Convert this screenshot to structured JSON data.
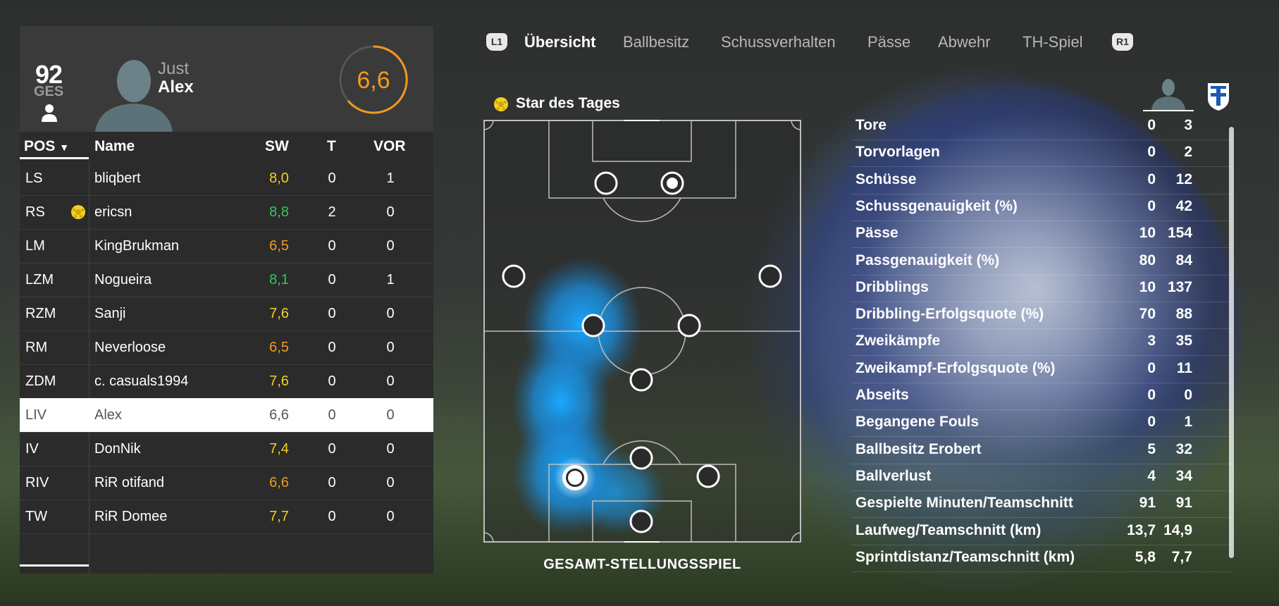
{
  "player": {
    "overall": "92",
    "overall_label": "GES",
    "first_name": "Just",
    "last_name": "Alex",
    "rating": "6,6"
  },
  "lineup": {
    "headers": {
      "pos": "POS",
      "name": "Name",
      "sw": "SW",
      "t": "T",
      "vor": "VOR"
    },
    "rows": [
      {
        "pos": "LS",
        "name": "bliqbert",
        "sw": "8,0",
        "t": "0",
        "vor": "1",
        "color": "#f5d021"
      },
      {
        "pos": "RS",
        "name": "ericsn",
        "sw": "8,8",
        "t": "2",
        "vor": "0",
        "color": "#35c75a",
        "star": true
      },
      {
        "pos": "LM",
        "name": "KingBrukman",
        "sw": "6,5",
        "t": "0",
        "vor": "0",
        "color": "#f29a1d"
      },
      {
        "pos": "LZM",
        "name": "Nogueira",
        "sw": "8,1",
        "t": "0",
        "vor": "1",
        "color": "#35c75a"
      },
      {
        "pos": "RZM",
        "name": "Sanji",
        "sw": "7,6",
        "t": "0",
        "vor": "0",
        "color": "#f5d021"
      },
      {
        "pos": "RM",
        "name": "Neverloose",
        "sw": "6,5",
        "t": "0",
        "vor": "0",
        "color": "#f29a1d"
      },
      {
        "pos": "ZDM",
        "name": "c. casuals1994",
        "sw": "7,6",
        "t": "0",
        "vor": "0",
        "color": "#f5d021"
      },
      {
        "pos": "LIV",
        "name": "Alex",
        "sw": "6,6",
        "t": "0",
        "vor": "0",
        "color": "#555555",
        "selected": true
      },
      {
        "pos": "IV",
        "name": "DonNik",
        "sw": "7,4",
        "t": "0",
        "vor": "0",
        "color": "#f5d021"
      },
      {
        "pos": "RIV",
        "name": "RiR otifand",
        "sw": "6,6",
        "t": "0",
        "vor": "0",
        "color": "#f29a1d"
      },
      {
        "pos": "TW",
        "name": "RiR Domee",
        "sw": "7,7",
        "t": "0",
        "vor": "0",
        "color": "#f5d021"
      }
    ]
  },
  "tabs": {
    "left_key": "L1",
    "right_key": "R1",
    "items": [
      "Übersicht",
      "Ballbesitz",
      "Schussverhalten",
      "Pässe",
      "Abwehr",
      "TH-Spiel"
    ]
  },
  "pitch": {
    "star_label": "Star des Tages",
    "caption": "GESAMT-STELLUNGSSPIEL"
  },
  "stats": [
    {
      "label": "Tore",
      "a": "0",
      "b": "3"
    },
    {
      "label": "Torvorlagen",
      "a": "0",
      "b": "2"
    },
    {
      "label": "Schüsse",
      "a": "0",
      "b": "12"
    },
    {
      "label": "Schussgenauigkeit (%)",
      "a": "0",
      "b": "42"
    },
    {
      "label": "Pässe",
      "a": "10",
      "b": "154"
    },
    {
      "label": "Passgenauigkeit (%)",
      "a": "80",
      "b": "84"
    },
    {
      "label": "Dribblings",
      "a": "10",
      "b": "137"
    },
    {
      "label": "Dribbling-Erfolgsquote (%)",
      "a": "70",
      "b": "88"
    },
    {
      "label": "Zweikämpfe",
      "a": "3",
      "b": "35"
    },
    {
      "label": "Zweikampf-Erfolgsquote (%)",
      "a": "0",
      "b": "11"
    },
    {
      "label": "Abseits",
      "a": "0",
      "b": "0"
    },
    {
      "label": "Begangene Fouls",
      "a": "0",
      "b": "1"
    },
    {
      "label": "Ballbesitz Erobert",
      "a": "5",
      "b": "32"
    },
    {
      "label": "Ballverlust",
      "a": "4",
      "b": "34"
    },
    {
      "label": "Gespielte Minuten/Teamschnitt",
      "a": "91",
      "b": "91"
    },
    {
      "label": "Laufweg/Teamschnitt (km)",
      "a": "13,7",
      "b": "14,9"
    },
    {
      "label": "Sprintdistanz/Teamschnitt (km)",
      "a": "5,8",
      "b": "7,7"
    }
  ],
  "colors": {
    "rating_orange": "#f29a1d",
    "good_green": "#35c75a",
    "ok_yellow": "#f5d021",
    "heat_blue": "#1aa7ff"
  }
}
